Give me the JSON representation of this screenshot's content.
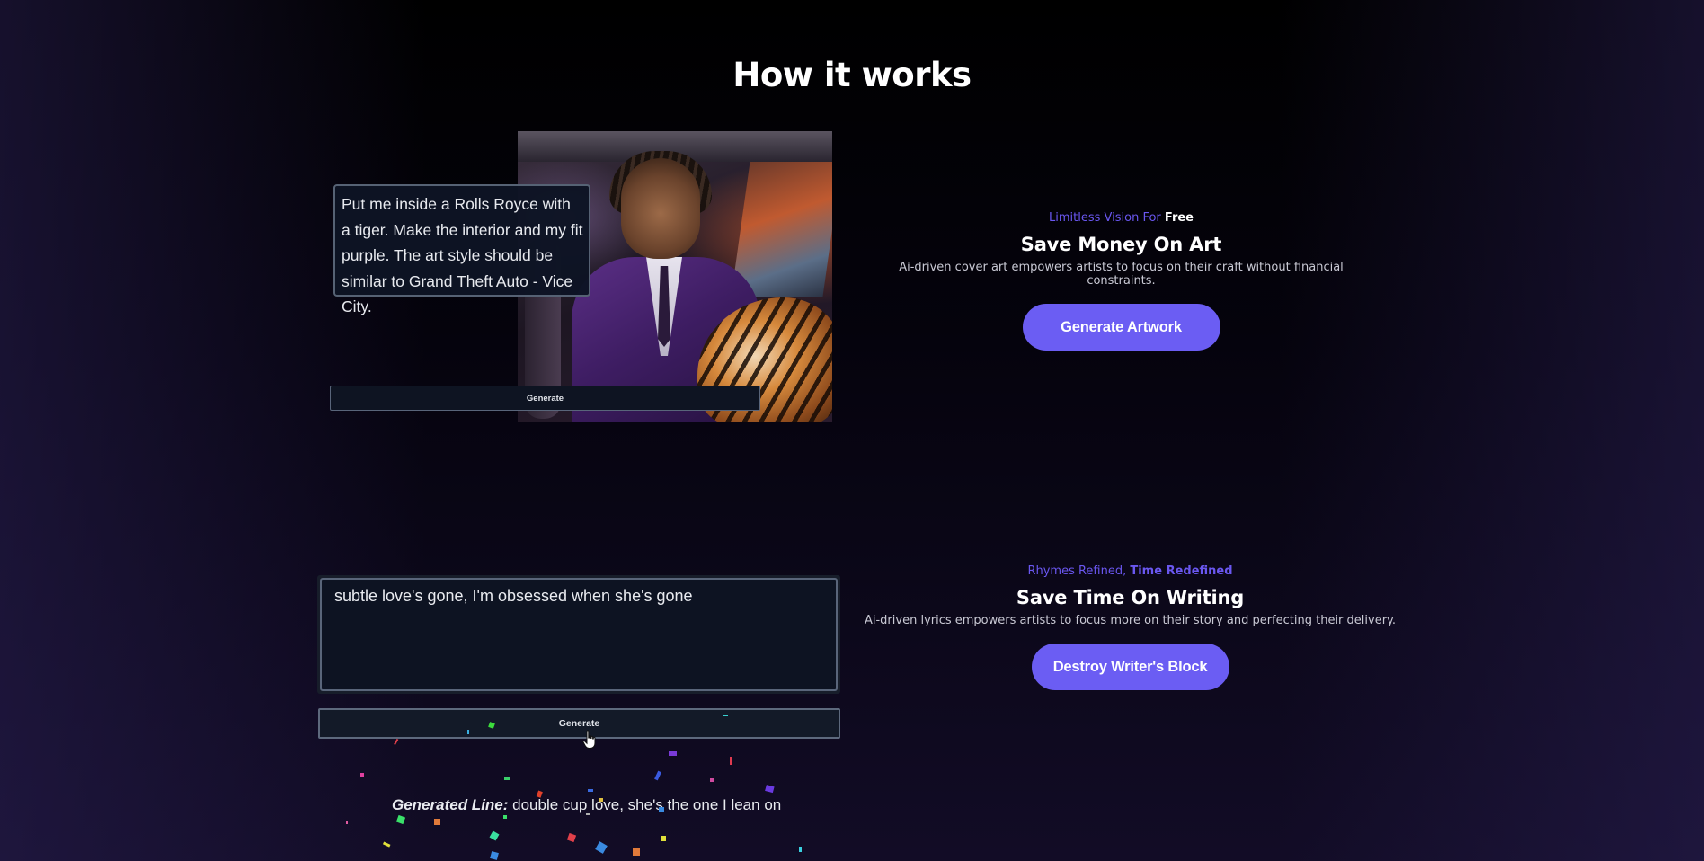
{
  "section": {
    "title": "How it works"
  },
  "artwork_demo": {
    "prompt_text": "Put me inside a Rolls Royce with a tiger. Make the interior and my fit purple. The art style should be similar to Grand Theft  Auto - Vice City.",
    "generate_label": "Generate"
  },
  "feature_art": {
    "kicker_prefix": "Limitless Vision For ",
    "kicker_highlight": "Free",
    "heading": "Save Money On Art",
    "description": "Ai-driven cover art empowers artists to focus on their craft without financial constraints.",
    "cta_label": "Generate Artwork"
  },
  "lyrics_demo": {
    "input_value": "subtle love's gone, I'm obsessed when she's gone",
    "generate_label": "Generate",
    "generated_label": "Generated Line:",
    "generated_value": " double cup love, she's the one I lean on"
  },
  "feature_lyrics": {
    "kicker_prefix": "Rhymes Refined, ",
    "kicker_highlight": "Time Redefined",
    "heading": "Save Time On Writing",
    "description": "Ai-driven lyrics empowers artists to focus more on their story and perfecting their delivery.",
    "cta_label": "Destroy Writer's Block"
  },
  "colors": {
    "accent": "#6b5df3",
    "kicker": "#6a57f0",
    "background": "#000000"
  }
}
